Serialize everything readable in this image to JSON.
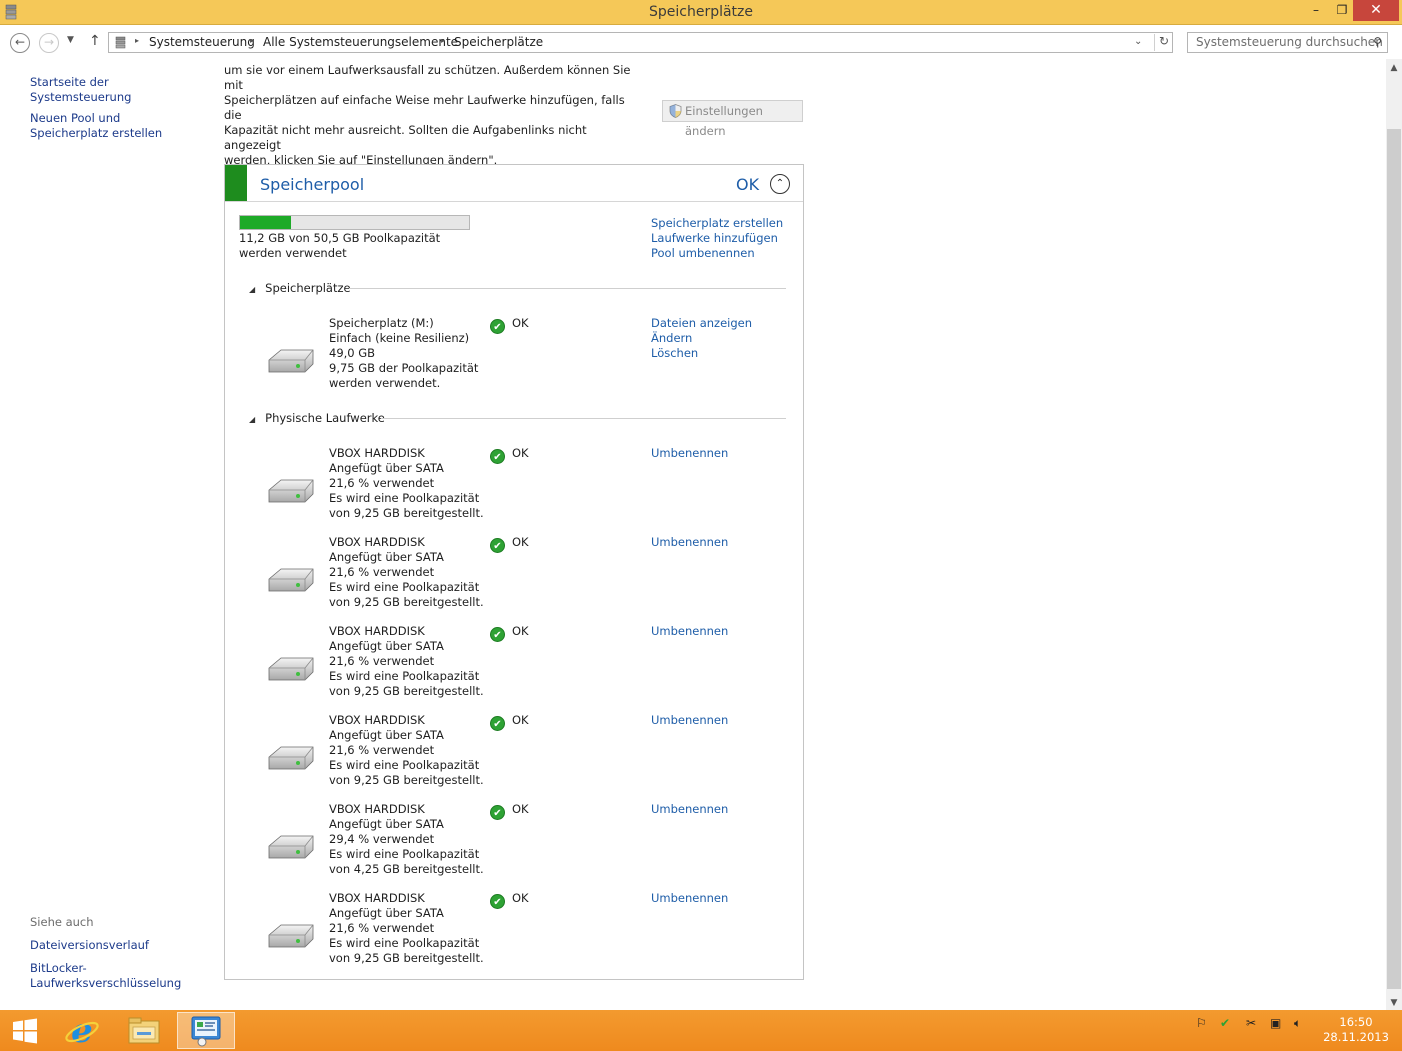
{
  "window": {
    "title": "Speicherplätze",
    "minimize": "–",
    "maximize": "❐",
    "close": "✕"
  },
  "nav": {
    "back": "←",
    "forward": "→",
    "dropdown": "▼",
    "up": "↑",
    "breadcrumbs": [
      "Systemsteuerung",
      "Alle Systemsteuerungselemente",
      "Speicherplätze"
    ],
    "separator": "▸",
    "address_dropdown": "⌄",
    "refresh": "↻",
    "search_placeholder": "Systemsteuerung durchsuchen",
    "search_icon": "⚲"
  },
  "sidebar": {
    "links": [
      "Startseite der Systemsteuerung",
      "Neuen Pool und Speicherplatz erstellen"
    ],
    "see_also_label": "Siehe auch",
    "see_also": [
      "Dateiversionsverlauf",
      "BitLocker-Laufwerksverschlüsselung"
    ]
  },
  "intro": {
    "text_lines": [
      "um sie vor einem Laufwerksausfall zu schützen. Außerdem können Sie mit",
      "Speicherplätzen auf einfache Weise mehr Laufwerke hinzufügen, falls die",
      "Kapazität nicht mehr ausreicht. Sollten die Aufgabenlinks nicht angezeigt",
      "werden, klicken Sie auf \"Einstellungen ändern\"."
    ],
    "settings_button": "Einstellungen ändern"
  },
  "pool": {
    "title": "Speicherpool",
    "status": "OK",
    "collapse_icon": "⌃",
    "usage_fraction": 0.222,
    "usage_text": "11,2 GB von 50,5 GB Poolkapazität werden verwendet",
    "links": [
      "Speicherplatz erstellen",
      "Laufwerke hinzufügen",
      "Pool umbenennen"
    ],
    "spaces_heading": "Speicherplätze",
    "drives_heading": "Physische Laufwerke",
    "collapse_triangle": "◢",
    "space": {
      "lines": [
        "Speicherplatz (M:)",
        "Einfach (keine Resilienz)",
        "49,0 GB",
        "9,75 GB der Poolkapazität",
        "werden verwendet."
      ],
      "status": "OK",
      "links": [
        "Dateien anzeigen",
        "Ändern",
        "Löschen"
      ]
    },
    "drives": [
      {
        "lines": [
          "VBOX HARDDISK",
          "Angefügt über SATA",
          "21,6 % verwendet",
          "Es wird eine Poolkapazität",
          "von 9,25 GB bereitgestellt."
        ],
        "status": "OK",
        "link": "Umbenennen"
      },
      {
        "lines": [
          "VBOX HARDDISK",
          "Angefügt über SATA",
          "21,6 % verwendet",
          "Es wird eine Poolkapazität",
          "von 9,25 GB bereitgestellt."
        ],
        "status": "OK",
        "link": "Umbenennen"
      },
      {
        "lines": [
          "VBOX HARDDISK",
          "Angefügt über SATA",
          "21,6 % verwendet",
          "Es wird eine Poolkapazität",
          "von 9,25 GB bereitgestellt."
        ],
        "status": "OK",
        "link": "Umbenennen"
      },
      {
        "lines": [
          "VBOX HARDDISK",
          "Angefügt über SATA",
          "21,6 % verwendet",
          "Es wird eine Poolkapazität",
          "von 9,25 GB bereitgestellt."
        ],
        "status": "OK",
        "link": "Umbenennen"
      },
      {
        "lines": [
          "VBOX HARDDISK",
          "Angefügt über SATA",
          "29,4 % verwendet",
          "Es wird eine Poolkapazität",
          "von 4,25 GB bereitgestellt."
        ],
        "status": "OK",
        "link": "Umbenennen"
      },
      {
        "lines": [
          "VBOX HARDDISK",
          "Angefügt über SATA",
          "21,6 % verwendet",
          "Es wird eine Poolkapazität",
          "von 9,25 GB bereitgestellt."
        ],
        "status": "OK",
        "link": "Umbenennen"
      }
    ]
  },
  "scrollbar": {
    "up": "▲",
    "down": "▼"
  },
  "taskbar": {
    "apps": [
      "internet-explorer-icon",
      "file-explorer-icon",
      "control-panel-icon"
    ],
    "clock_time": "16:50",
    "clock_date": "28.11.2013"
  },
  "colors": {
    "titlebar": "#f5c858",
    "taskbar": "#ef8a1e",
    "link": "#1e5da8",
    "ok_green": "#2ea234",
    "pool_stripe": "#1e8c1e"
  }
}
